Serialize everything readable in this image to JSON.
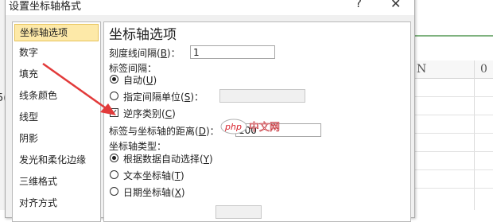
{
  "dialog": {
    "title": "设置坐标轴格式",
    "help_glyph": "?",
    "close_glyph": "✕"
  },
  "categories": [
    "坐标轴选项",
    "数字",
    "填充",
    "线条颜色",
    "线型",
    "阴影",
    "发光和柔化边缘",
    "三维格式",
    "对齐方式"
  ],
  "selected_category": "坐标轴选项",
  "panel": {
    "title": "坐标轴选项",
    "tick_interval": {
      "label": "刻度线间隔(",
      "key": "B",
      "suffix": ")：",
      "value": "1"
    },
    "label_interval": {
      "label": "标签间隔："
    },
    "auto": {
      "label": "自动(",
      "key": "U",
      "suffix": ")",
      "selected": true
    },
    "specify_unit": {
      "label": "指定间隔单位(",
      "key": "S",
      "suffix": ")：",
      "selected": false
    },
    "reverse": {
      "label": "逆序类别(",
      "key": "C",
      "suffix": ")",
      "checked": true,
      "check_glyph": "✓"
    },
    "label_distance": {
      "label": "标签与坐标轴的距离(",
      "key": "D",
      "suffix": ")：",
      "value": "100"
    },
    "axis_type": {
      "label": "坐标轴类型："
    },
    "by_data": {
      "label": "根据数据自动选择(",
      "key": "Y",
      "suffix": ")",
      "selected": true
    },
    "text_axis": {
      "label": "文本坐标轴(",
      "key": "T",
      "suffix": ")",
      "selected": false
    },
    "date_axis": {
      "label": "日期坐标轴(",
      "key": "X",
      "suffix": ")",
      "selected": false
    }
  },
  "watermark": {
    "text": "php",
    "text2": "中文网"
  },
  "sheet": {
    "col_n": "N",
    "col_o": "0",
    "left_fragment": "5("
  },
  "colors": {
    "arrow": "#e23a3a",
    "selection": "#fde9a8"
  }
}
